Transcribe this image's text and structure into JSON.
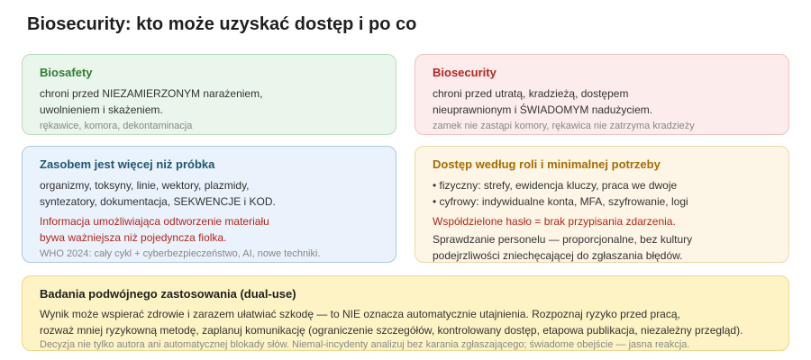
{
  "page": {
    "title": "Biosecurity: kto może uzyskać dostęp i po co"
  },
  "colors": {
    "biosafety_accent": "#2e7d32",
    "biosecurity_accent": "#b3261e",
    "asset_accent": "#1f5673",
    "access_accent": "#a86b00",
    "warning": "#b3261e",
    "note": "#888888"
  },
  "cards": {
    "biosafety": {
      "title": "Biosafety",
      "lines": [
        "chroni przed NIEZAMIERZONYM narażeniem,",
        "uwolnieniem i skażeniem."
      ],
      "note": "rękawice, komora, dekontaminacja"
    },
    "biosecurity": {
      "title": "Biosecurity",
      "lines": [
        "chroni przed utratą, kradzieżą, dostępem",
        "nieuprawnionym i ŚWIADOMYM nadużyciem."
      ],
      "note": "zamek nie zastąpi komory, rękawica nie zatrzyma kradzieży"
    },
    "asset": {
      "title": "Zasobem jest więcej niż próbka",
      "lines": [
        "organizmy, toksyny, linie, wektory, plazmidy,",
        "syntezatory, dokumentacja, SEKWENCJE i KOD."
      ],
      "warning_lines": [
        "Informacja umożliwiająca odtworzenie materiału",
        "bywa ważniejsza niż pojedyncza fiolka."
      ],
      "note": "WHO 2024: cały cykl + cyberbezpieczeństwo, AI, nowe techniki."
    },
    "access": {
      "title": "Dostęp według roli i minimalnej potrzeby",
      "bullets": [
        "• fizyczny: strefy, ewidencja kluczy, praca we dwoje",
        "• cyfrowy: indywidualne konta, MFA, szyfrowanie, logi"
      ],
      "warning": "Współdzielone hasło = brak przypisania zdarzenia.",
      "lines": [
        "Sprawdzanie personelu — proporcjonalne, bez kultury",
        "podejrzliwości zniechęcającej do zgłaszania błędów."
      ]
    },
    "dualuse": {
      "title": "Badania podwójnego zastosowania (dual-use)",
      "lines": [
        "Wynik może wspierać zdrowie i zarazem ułatwiać szkodę — to NIE oznacza automatycznie utajnienia. Rozpoznaj ryzyko przed pracą,",
        "rozważ mniej ryzykowną metodę, zaplanuj komunikację (ograniczenie szczegółów, kontrolowany dostęp, etapowa publikacja, niezależny przegląd)."
      ],
      "note": "Decyzja nie tylko autora ani automatycznej blokady słów. Niemal-incydenty analizuj bez karania zgłaszającego; świadome obejście — jasna reakcja."
    }
  }
}
